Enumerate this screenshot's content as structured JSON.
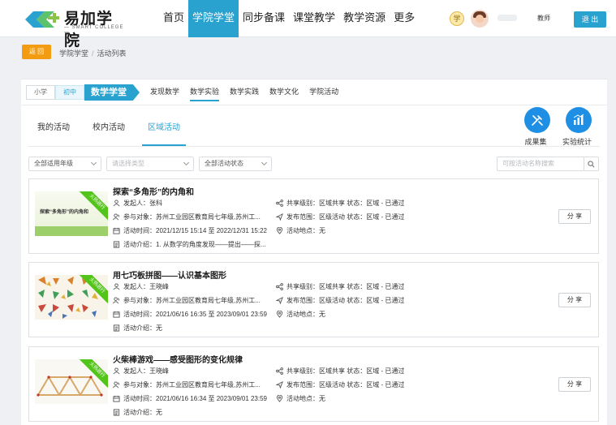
{
  "header": {
    "logo_name": "易加学院",
    "logo_sub": "— SMART COLLEGE —",
    "nav": [
      "首页",
      "学院学堂",
      "同步备课",
      "课堂教学",
      "教学资源",
      "更多"
    ],
    "active_nav": 1,
    "badge_text": "学",
    "role": "教师",
    "logout": "退 出"
  },
  "breadcrumb": {
    "back": "返 回",
    "items": [
      "学院学堂",
      "活动列表"
    ]
  },
  "levels": [
    "小学",
    "初中"
  ],
  "subject_tag": "数学学堂",
  "subtabs": [
    "发现数学",
    "数学实验",
    "数学实践",
    "数学文化",
    "学院活动"
  ],
  "activity_tabs": [
    "我的活动",
    "校内活动",
    "区域活动"
  ],
  "tools": [
    {
      "label": "成果集",
      "icon": "edit-ruler-icon"
    },
    {
      "label": "实验统计",
      "icon": "bar-chart-icon"
    }
  ],
  "filters": {
    "grade": "全部适用年级",
    "type_placeholder": "请选择类型",
    "status": "全部活动状态",
    "search_placeholder": "可按活动名称搜索"
  },
  "labels": {
    "initiator": "发起人：",
    "target": "参与对象：",
    "time": "活动时间：",
    "intro": "活动介绍：",
    "share_level": "共享级别：",
    "scope": "发布范围：",
    "place": "活动地点：",
    "share_btn": "分 享",
    "ribbon": "火热进行"
  },
  "cards": [
    {
      "title": "探索“多角形”的内角和",
      "initiator": "张科",
      "target": "苏州工业园区教育局七年级,苏州工...",
      "time": "2021/12/15 15:14 至 2022/12/31 15:22",
      "intro": "1. 从数学的角度发现——提出——探...",
      "share_level": "区域共享 状态：区域 - 已通过",
      "scope": "区级活动 状态：区域 - 已通过",
      "place": "无"
    },
    {
      "title": "用七巧板拼图——认识基本图形",
      "initiator": "王晓峰",
      "target": "苏州工业园区教育局七年级,苏州工...",
      "time": "2021/06/16 16:35 至 2023/09/01 23:59",
      "intro": "无",
      "share_level": "区域共享 状态：区域 - 已通过",
      "scope": "区级活动 状态：区域 - 已通过",
      "place": "无"
    },
    {
      "title": "火柴棒游戏——感受图形的变化规律",
      "initiator": "王晓峰",
      "target": "苏州工业园区教育局七年级,苏州工...",
      "time": "2021/06/16 16:34 至 2023/09/01 23:59",
      "intro": "无",
      "share_level": "区域共享 状态：区域 - 已通过",
      "scope": "区级活动 状态：区域 - 已通过",
      "place": "无"
    }
  ],
  "thumb1_text": "探索“多角形”的内角和",
  "colors": {
    "primary": "#2aa2d0",
    "orange": "#f39c12",
    "green": "#52c41a",
    "tool": "#1f8fe6"
  }
}
